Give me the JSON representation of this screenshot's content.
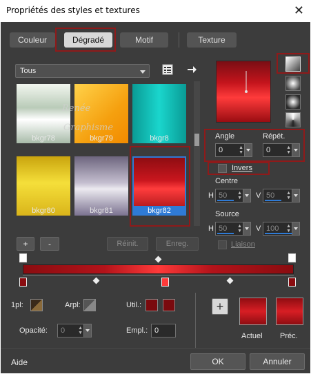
{
  "window": {
    "title": "Propriétés des styles et textures",
    "close_glyph": "✕"
  },
  "tabs": [
    {
      "label": "Couleur"
    },
    {
      "label": "Dégradé"
    },
    {
      "label": "Motif"
    },
    {
      "label": "Texture"
    }
  ],
  "library": {
    "filter_value": "Tous",
    "swatches": [
      {
        "label": "bkgr78"
      },
      {
        "label": "bkgr79"
      },
      {
        "label": "bkgr8"
      },
      {
        "label": "bkgr80"
      },
      {
        "label": "bkgr81"
      },
      {
        "label": "bkgr82"
      }
    ],
    "watermark_line1": "Renée",
    "watermark_line2": "Graphisme",
    "add_label": "+",
    "remove_label": "-",
    "reset_label": "Réinit.",
    "save_label": "Enreg."
  },
  "gradient": {
    "angle_label": "Angle",
    "angle_value": "0",
    "repeat_label": "Répét.",
    "repeat_value": "0",
    "invert_label": "Invers",
    "center_label": "Centre",
    "center_h_label": "H",
    "center_h_value": "50",
    "center_v_label": "V",
    "center_v_value": "50",
    "source_label": "Source",
    "source_h_label": "H",
    "source_h_value": "50",
    "source_v_label": "V",
    "source_v_value": "100",
    "link_label": "Liaison"
  },
  "stops": {
    "fg_label": "1pl:",
    "bg_label": "Arpl:",
    "user_label": "Util.:",
    "opacity_label": "Opacité:",
    "opacity_value": "0",
    "location_label": "Empl.:",
    "location_value": "0",
    "current_label": "Actuel",
    "previous_label": "Préc.",
    "add_label": "+"
  },
  "footer": {
    "help_label": "Aide",
    "ok_label": "OK",
    "cancel_label": "Annuler"
  },
  "colors": {
    "accent_blue": "#2f7bd6",
    "highlight_red": "#8f1a1a",
    "gradient_red": "#d81e24",
    "dark_red": "#7a0e14"
  }
}
